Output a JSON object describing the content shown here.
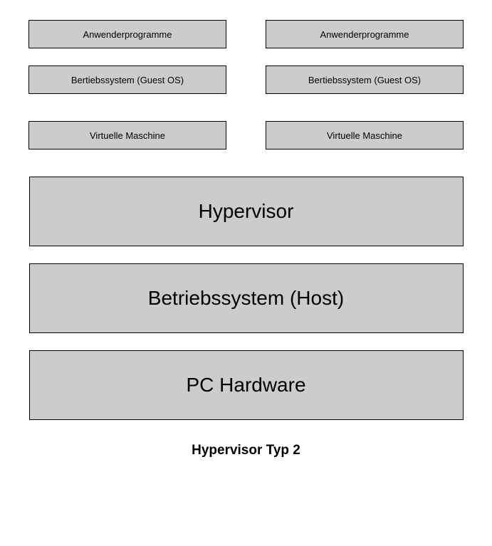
{
  "vm_rows": [
    {
      "left": "Anwenderprogramme",
      "right": "Anwenderprogramme"
    },
    {
      "left": "Bertiebssystem (Guest OS)",
      "right": "Bertiebssystem (Guest OS)"
    },
    {
      "left": "Virtuelle Maschine",
      "right": "Virtuelle Maschine"
    }
  ],
  "layers": {
    "hypervisor": "Hypervisor",
    "host_os": "Betriebssystem (Host)",
    "hardware": "PC Hardware"
  },
  "caption": "Hypervisor Typ 2"
}
